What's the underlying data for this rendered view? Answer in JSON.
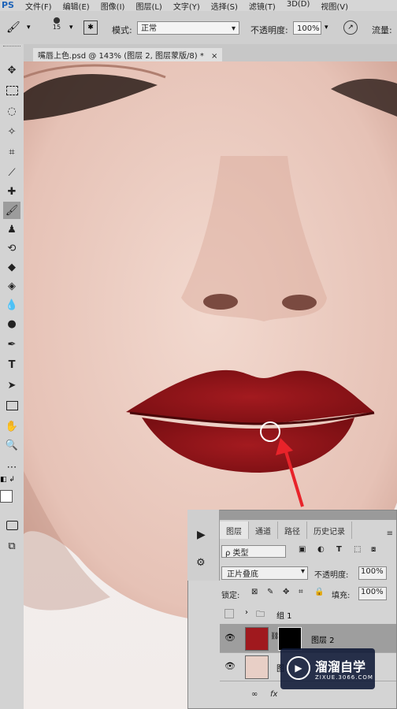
{
  "app": {
    "logo": "PS"
  },
  "menu": [
    "文件(F)",
    "编辑(E)",
    "图像(I)",
    "图层(L)",
    "文字(Y)",
    "选择(S)",
    "滤镜(T)",
    "3D(D)",
    "视图(V)"
  ],
  "options": {
    "brush_size": "15",
    "mode_label": "模式:",
    "mode_value": "正常",
    "opacity_label": "不透明度:",
    "opacity_value": "100%",
    "flow_label": "流量:"
  },
  "document": {
    "tab_title": "嘴唇上色.psd @ 143% (图层 2, 图层蒙版/8) *",
    "close": "×"
  },
  "layers_panel": {
    "tabs": [
      "图层",
      "通道",
      "路径",
      "历史记录"
    ],
    "filter_label": "ρ 类型",
    "blend_mode": "正片叠底",
    "opacity_label": "不透明度:",
    "opacity_value": "100%",
    "lock_label": "锁定:",
    "fill_label": "填充:",
    "fill_value": "100%",
    "layers": [
      {
        "name": "组 1"
      },
      {
        "name": "图层 2"
      },
      {
        "name": "图"
      }
    ],
    "footer": [
      "∞",
      "fx"
    ]
  },
  "watermark": {
    "title": "溜溜自学",
    "subtitle": "ZIXUE.3066.COM"
  },
  "colors": {
    "lip": "#8e1418",
    "skin": "#e8c8bc",
    "highlight_arrow": "#e8232a"
  }
}
